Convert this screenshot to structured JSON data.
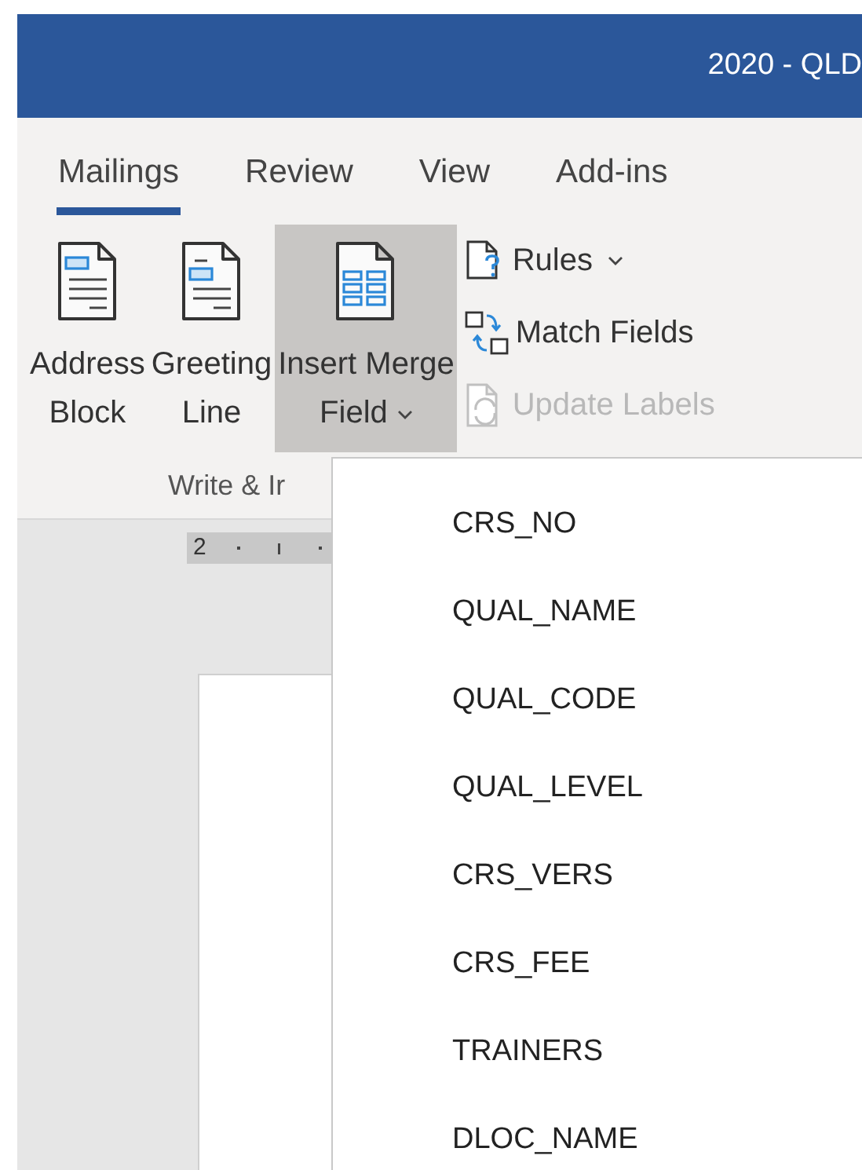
{
  "window": {
    "title": "2020 - QLD"
  },
  "tabs": [
    {
      "label": "Mailings",
      "selected": true
    },
    {
      "label": "Review",
      "selected": false
    },
    {
      "label": "View",
      "selected": false
    },
    {
      "label": "Add-ins",
      "selected": false
    }
  ],
  "ribbon": {
    "large_buttons": [
      {
        "kind": "address",
        "lines": [
          "Address",
          "Block"
        ],
        "pressed": false,
        "dropdown": false
      },
      {
        "kind": "greeting",
        "lines": [
          "Greeting",
          "Line"
        ],
        "pressed": false,
        "dropdown": false
      },
      {
        "kind": "merge",
        "lines": [
          "Insert Merge",
          "Field"
        ],
        "pressed": true,
        "dropdown": true
      }
    ],
    "small_buttons": [
      {
        "kind": "rules",
        "label": "Rules",
        "disabled": false,
        "dropdown": true
      },
      {
        "kind": "match",
        "label": "Match Fields",
        "disabled": false,
        "dropdown": false
      },
      {
        "kind": "update",
        "label": "Update Labels",
        "disabled": true,
        "dropdown": false
      }
    ],
    "group_label": "Write & Ir"
  },
  "ruler": {
    "label": "2"
  },
  "dropdown_menu": {
    "items": [
      "CRS_NO",
      "QUAL_NAME",
      "QUAL_CODE",
      "QUAL_LEVEL",
      "CRS_VERS",
      "CRS_FEE",
      "TRAINERS",
      "DLOC_NAME"
    ]
  }
}
